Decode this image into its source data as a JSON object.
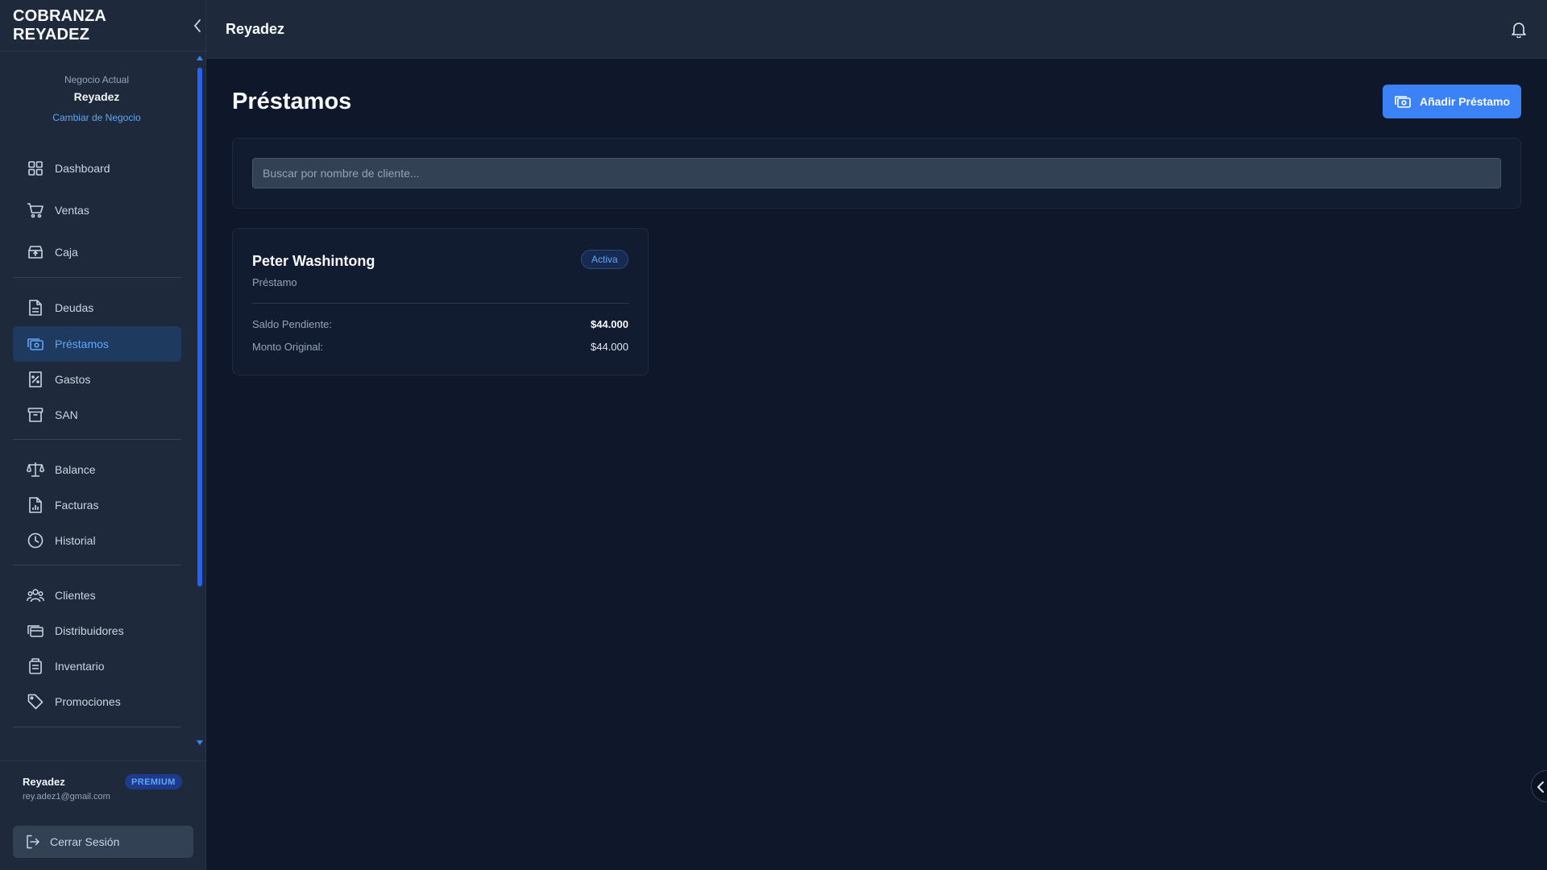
{
  "app": {
    "brand": "COBRANZA REYADEZ",
    "topbar_title": "Reyadez"
  },
  "business": {
    "label": "Negocio Actual",
    "name": "Reyadez",
    "change": "Cambiar de Negocio"
  },
  "nav": [
    {
      "label": "Dashboard",
      "icon": "dashboard-icon"
    },
    {
      "label": "Ventas",
      "icon": "cart-icon"
    },
    {
      "label": "Caja",
      "icon": "cash-box-icon"
    },
    {
      "label": "Deudas",
      "icon": "document-icon"
    },
    {
      "label": "Préstamos",
      "icon": "banknote-icon",
      "active": true
    },
    {
      "label": "Gastos",
      "icon": "receipt-icon"
    },
    {
      "label": "SAN",
      "icon": "archive-icon"
    },
    {
      "label": "Balance",
      "icon": "scale-icon"
    },
    {
      "label": "Facturas",
      "icon": "invoice-chart-icon"
    },
    {
      "label": "Historial",
      "icon": "clock-icon"
    },
    {
      "label": "Clientes",
      "icon": "users-icon"
    },
    {
      "label": "Distribuidores",
      "icon": "distributor-icon"
    },
    {
      "label": "Inventario",
      "icon": "inventory-icon"
    },
    {
      "label": "Promociones",
      "icon": "tag-icon"
    }
  ],
  "user": {
    "name": "Reyadez",
    "email": "rey.adez1@gmail.com",
    "plan": "PREMIUM",
    "logout": "Cerrar Sesión"
  },
  "page": {
    "title": "Préstamos",
    "add_button": "Añadir Préstamo",
    "search_placeholder": "Buscar por nombre de cliente..."
  },
  "loans": [
    {
      "client": "Peter Washintong",
      "type": "Préstamo",
      "status": "Activa",
      "pending_label": "Saldo Pendiente:",
      "pending_value": "$44.000",
      "original_label": "Monto Original:",
      "original_value": "$44.000"
    }
  ],
  "colors": {
    "background": "#0f172a",
    "sidebar": "#1e293b",
    "accent": "#3b82f6",
    "active_nav": "#1e3a5f"
  }
}
